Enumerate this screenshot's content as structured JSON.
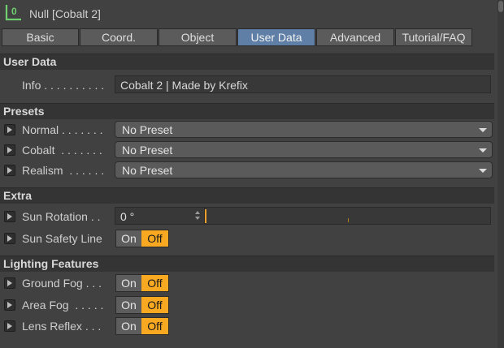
{
  "header": {
    "icon": "null-object-icon",
    "title": "Null [Cobalt 2]"
  },
  "tabs": [
    {
      "label": "Basic",
      "active": false
    },
    {
      "label": "Coord.",
      "active": false
    },
    {
      "label": "Object",
      "active": false
    },
    {
      "label": "User Data",
      "active": true
    },
    {
      "label": "Advanced",
      "active": false
    },
    {
      "label": "Tutorial/FAQ",
      "active": false
    }
  ],
  "sections": {
    "user_data": {
      "title": "User Data",
      "info_label": "Info . . . . . . . . . .",
      "info_value": "Cobalt 2 | Made by Krefix"
    },
    "presets": {
      "title": "Presets",
      "rows": [
        {
          "label": "Normal . . . . . . .",
          "value": "No Preset"
        },
        {
          "label": "Cobalt  . . . . . . .",
          "value": "No Preset"
        },
        {
          "label": "Realism  . . . . . .",
          "value": "No Preset"
        }
      ]
    },
    "extra": {
      "title": "Extra",
      "sun_rotation_label": "Sun Rotation . .",
      "sun_rotation_value": "0 °",
      "sun_safety_label": "Sun Safety Line",
      "on_label": "On",
      "off_label": "Off"
    },
    "lighting": {
      "title": "Lighting Features",
      "rows": [
        {
          "label": "Ground Fog . . .",
          "on": "On",
          "off": "Off"
        },
        {
          "label": "Area Fog  . . . . .",
          "on": "On",
          "off": "Off"
        },
        {
          "label": "Lens Reflex . . .",
          "on": "On",
          "off": "Off"
        }
      ]
    }
  },
  "colors": {
    "accent_active_tab": "#5f7fa7",
    "toggle_off_active": "#f8a921",
    "panel_bg": "#414141"
  }
}
